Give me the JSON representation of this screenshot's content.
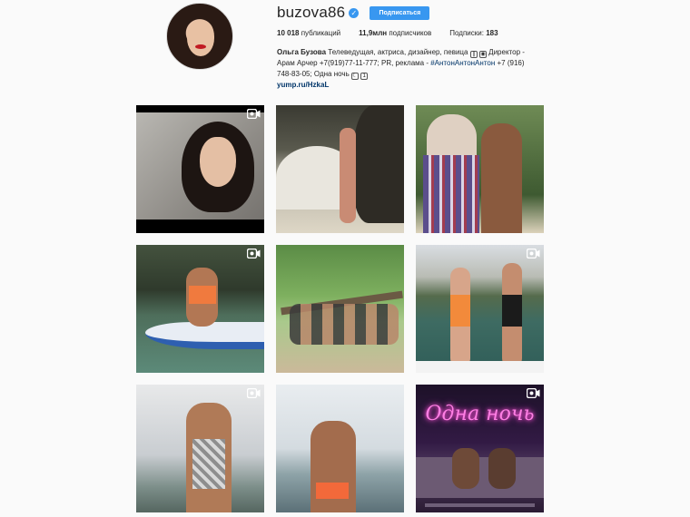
{
  "profile": {
    "username": "buzova86",
    "verified_icon": "verified-badge-icon",
    "follow_label": "Подписаться",
    "stats": {
      "posts_value": "10 018",
      "posts_label": "публикаций",
      "followers_value": "11,9млн",
      "followers_label": "подписчиков",
      "following_label": "Подписки:",
      "following_value": "183"
    },
    "bio": {
      "name": "Ольга Бузова",
      "text1": "Телеведущая, актриса, дизайнер, певица",
      "icons1": [
        "paperclip-icon",
        "camera-icon"
      ],
      "text2": "Директор - Арам Арчер +7(919)77-11-777; PR, реклама -",
      "hashtag": "#АнтонАнтонАнтон",
      "text3": "+7 (916) 748-83-05; Одна ночь",
      "icons2": [
        "moon-emoji-icon",
        "one-keycap-icon"
      ]
    },
    "website": "yump.ru/HzkaL"
  },
  "posts": [
    {
      "type": "video",
      "icon": "video-icon"
    },
    {
      "type": "photo"
    },
    {
      "type": "photo"
    },
    {
      "type": "video",
      "icon": "video-icon"
    },
    {
      "type": "photo"
    },
    {
      "type": "video",
      "icon": "video-icon"
    },
    {
      "type": "video",
      "icon": "video-icon"
    },
    {
      "type": "photo"
    },
    {
      "type": "video",
      "icon": "video-icon",
      "neon_text": "Одна ночь"
    }
  ],
  "colors": {
    "accent": "#3897f0",
    "link": "#003569",
    "background": "#fafafa",
    "text": "#262626"
  }
}
